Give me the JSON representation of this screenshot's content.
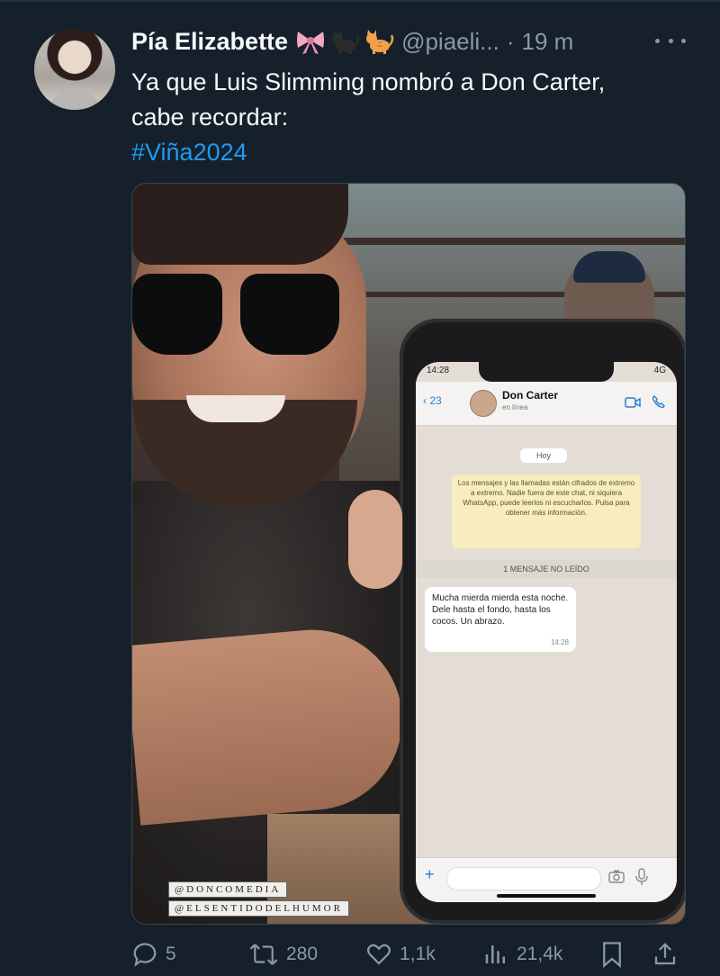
{
  "tweet": {
    "author_name": "Pía Elizabette",
    "handle": "@piaeli...",
    "separator": "·",
    "time": "19 m",
    "name_emojis": [
      "ribbon-emoji",
      "black-cat-emoji",
      "cat-emoji"
    ],
    "text_line_1": "Ya que Luis Slimming nombró a Don Carter,",
    "text_line_2": "cabe recordar:",
    "hashtag": "#Viña2024"
  },
  "media": {
    "phone": {
      "status_time": "14:28",
      "status_right": "4G",
      "back_count": "23",
      "contact_name": "Don Carter",
      "contact_status": "en línea",
      "date_pill": "Hoy",
      "encryption_notice": "Los mensajes y las llamadas están cifrados de extremo a extremo. Nadie fuera de este chat, ni siquiera WhatsApp, puede leerlos ni escucharlos. Pulsa para obtener más información.",
      "unread_banner": "1 MENSAJE NO LEÍDO",
      "message_text": "Mucha mierda mierda esta noche. Dele hasta el fondo, hasta los cocos. Un abrazo.",
      "message_time": "14:28",
      "input_plus": "+"
    },
    "watermark_1": "@DONCOMEDIA",
    "watermark_2": "@ELSENTIDODELHUMOR"
  },
  "actions": {
    "replies": "5",
    "reposts": "280",
    "likes": "1,1k",
    "views": "21,4k"
  },
  "colors": {
    "background": "#15202b",
    "text": "#f7f9f9",
    "muted": "#8b98a5",
    "accent": "#1d9bf0"
  }
}
